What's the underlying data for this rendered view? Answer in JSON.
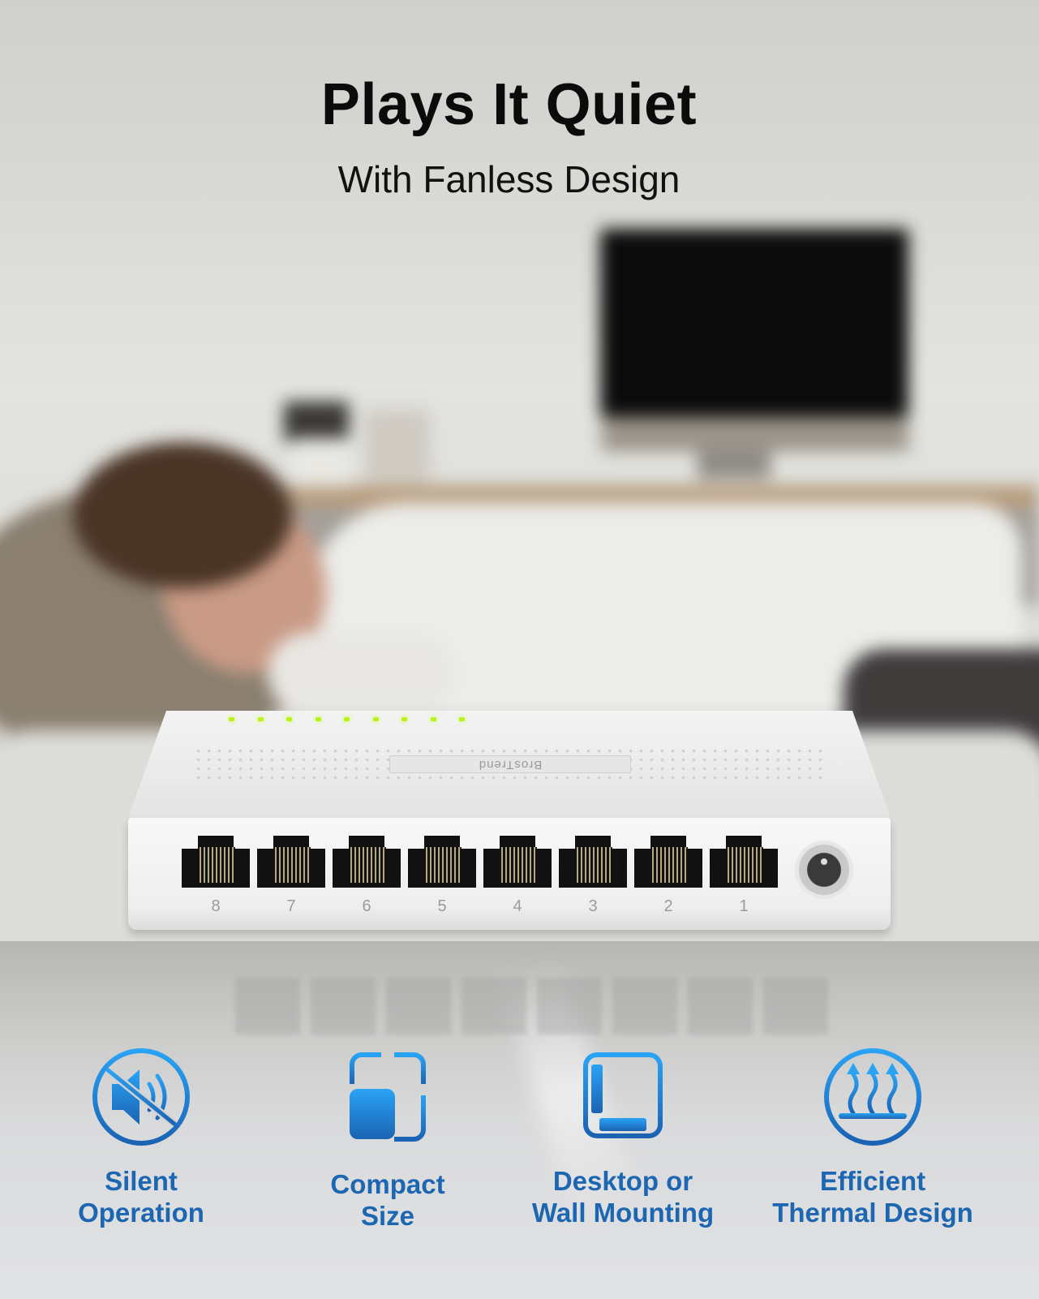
{
  "headline": {
    "title": "Plays It Quiet",
    "subtitle": "With Fanless Design"
  },
  "product": {
    "brand": "BrosTrend",
    "type": "8-port ethernet switch",
    "port_labels": [
      "8",
      "7",
      "6",
      "5",
      "4",
      "3",
      "2",
      "1"
    ],
    "led_count": 9,
    "led_color": "#b8f21a",
    "power_port": "dc-jack"
  },
  "features": [
    {
      "icon": "speaker-muted-icon",
      "label_line1": "Silent",
      "label_line2": "Operation"
    },
    {
      "icon": "compact-size-icon",
      "label_line1": "Compact",
      "label_line2": "Size"
    },
    {
      "icon": "desktop-wall-mount-icon",
      "label_line1": "Desktop or",
      "label_line2": "Wall Mounting"
    },
    {
      "icon": "heat-dissipation-icon",
      "label_line1": "Efficient",
      "label_line2": "Thermal Design"
    }
  ],
  "colors": {
    "feature_text": "#1d66b2",
    "icon_gradient_top": "#2aa3f5",
    "icon_gradient_bottom": "#1b63b3",
    "headline_text": "#0b0b0b"
  }
}
